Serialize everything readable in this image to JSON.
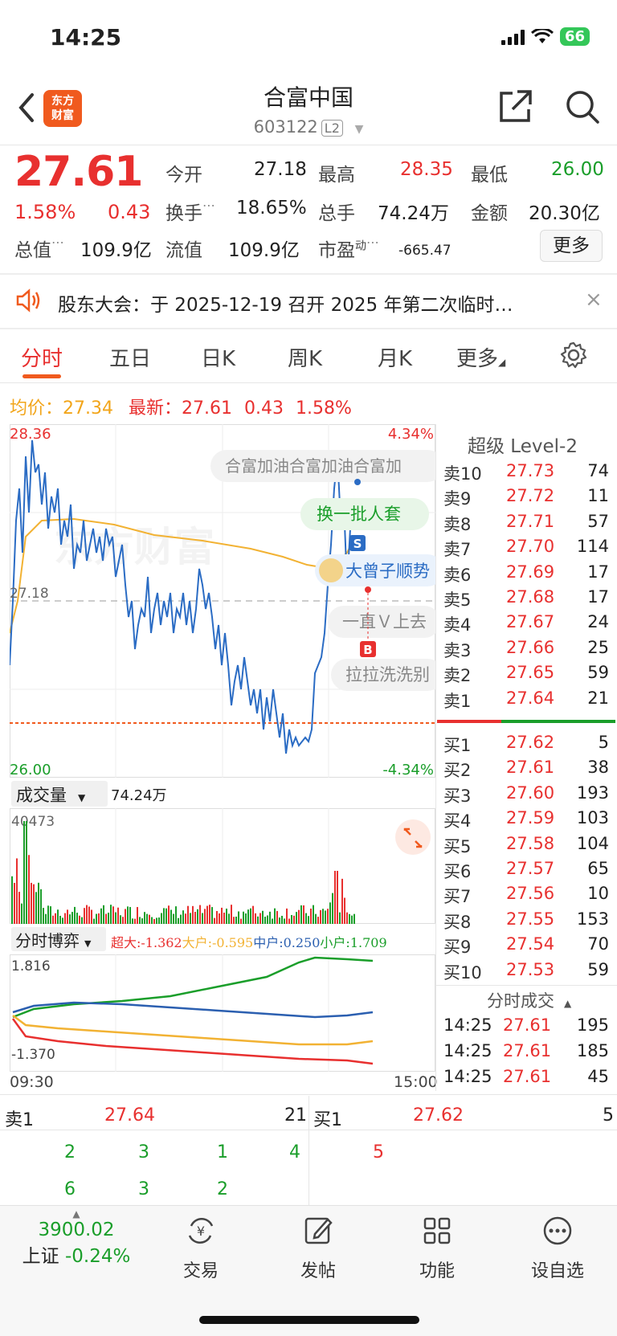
{
  "status_bar": {
    "time": "14:25",
    "battery": "66"
  },
  "header": {
    "title": "合富中国",
    "code": "603122",
    "level_tag": "L2",
    "logo_line1": "东方",
    "logo_line2": "财富"
  },
  "quote": {
    "price": "27.61",
    "pct": "1.58%",
    "change": "0.43",
    "open_label": "今开",
    "open": "27.18",
    "high_label": "最高",
    "high": "28.35",
    "low_label": "最低",
    "low": "26.00",
    "turnover_label": "换手",
    "turnover": "18.65%",
    "volume_label": "总手",
    "volume": "74.24万",
    "amount_label": "金额",
    "amount": "20.30亿",
    "mktcap_label": "总值",
    "mktcap": "109.9亿",
    "float_label": "流值",
    "float": "109.9亿",
    "pe_label": "市盈",
    "pe_sup": "动",
    "pe": "-665.47",
    "more_label": "更多"
  },
  "notice": {
    "text": "股东大会：于 2025-12-19 召开 2025 年第二次临时…",
    "close": "×"
  },
  "tabs": [
    "分时",
    "五日",
    "日K",
    "周K",
    "月K",
    "更多"
  ],
  "info_line": {
    "avg_label": "均价：",
    "avg": "27.34",
    "latest_label": "最新：",
    "latest": "27.61",
    "chg": "0.43",
    "pct": "1.58%"
  },
  "chart_labels": {
    "max_price": "28.36",
    "min_price": "26.00",
    "mid_price": "27.18",
    "max_pct": "4.34%",
    "min_pct": "-4.34%",
    "volume_title": "成交量",
    "volume_total": "74.24万",
    "volume_max": "40473",
    "game_title": "分时博弈",
    "game_legend": [
      {
        "label": "超大:-1.362",
        "color": "#e8302f"
      },
      {
        "label": "大户:-0.595",
        "color": "#f2b233"
      },
      {
        "label": "中户:0.250",
        "color": "#2b5fb0"
      },
      {
        "label": "小户:1.709",
        "color": "#1a9e2a"
      }
    ],
    "game_max": "1.816",
    "game_min": "-1.370",
    "time_start": "09:30",
    "time_end": "15:00"
  },
  "comments": [
    "合富加油合富加油合富加",
    "换一批人套",
    "大曾子顺势",
    "一直Ｖ上去",
    "拉拉洗洗别"
  ],
  "markers": {
    "sell": "S",
    "buy": "B"
  },
  "orderbook": {
    "title": "超级 Level-2",
    "asks": [
      {
        "label": "卖10",
        "price": "27.73",
        "vol": "74"
      },
      {
        "label": "卖9",
        "price": "27.72",
        "vol": "11"
      },
      {
        "label": "卖8",
        "price": "27.71",
        "vol": "57"
      },
      {
        "label": "卖7",
        "price": "27.70",
        "vol": "114"
      },
      {
        "label": "卖6",
        "price": "27.69",
        "vol": "17"
      },
      {
        "label": "卖5",
        "price": "27.68",
        "vol": "17"
      },
      {
        "label": "卖4",
        "price": "27.67",
        "vol": "24"
      },
      {
        "label": "卖3",
        "price": "27.66",
        "vol": "25"
      },
      {
        "label": "卖2",
        "price": "27.65",
        "vol": "59"
      },
      {
        "label": "卖1",
        "price": "27.64",
        "vol": "21"
      }
    ],
    "bids": [
      {
        "label": "买1",
        "price": "27.62",
        "vol": "5"
      },
      {
        "label": "买2",
        "price": "27.61",
        "vol": "38"
      },
      {
        "label": "买3",
        "price": "27.60",
        "vol": "193"
      },
      {
        "label": "买4",
        "price": "27.59",
        "vol": "103"
      },
      {
        "label": "买5",
        "price": "27.58",
        "vol": "104"
      },
      {
        "label": "买6",
        "price": "27.57",
        "vol": "65"
      },
      {
        "label": "买7",
        "price": "27.56",
        "vol": "10"
      },
      {
        "label": "买8",
        "price": "27.55",
        "vol": "153"
      },
      {
        "label": "买9",
        "price": "27.54",
        "vol": "70"
      },
      {
        "label": "买10",
        "price": "27.53",
        "vol": "59"
      }
    ],
    "ticks_title": "分时成交",
    "ticks": [
      {
        "time": "14:25",
        "price": "27.61",
        "vol": "195"
      },
      {
        "time": "14:25",
        "price": "27.61",
        "vol": "185"
      },
      {
        "time": "14:25",
        "price": "27.61",
        "vol": "45"
      }
    ]
  },
  "bottom_quote": {
    "sell1_label": "卖1",
    "sell1_price": "27.64",
    "sell1_vol": "21",
    "buy1_label": "买1",
    "buy1_price": "27.62",
    "buy1_vol": "5",
    "sell_queue_row1": [
      "2",
      "3",
      "1",
      "4"
    ],
    "sell_queue_row2": [
      "6",
      "3",
      "2"
    ],
    "buy_queue": [
      "5"
    ]
  },
  "bottom_nav": {
    "index_value": "3900.02",
    "index_name": "上证",
    "index_pct": "-0.24%",
    "items": [
      "交易",
      "发帖",
      "功能",
      "设自选"
    ]
  }
}
